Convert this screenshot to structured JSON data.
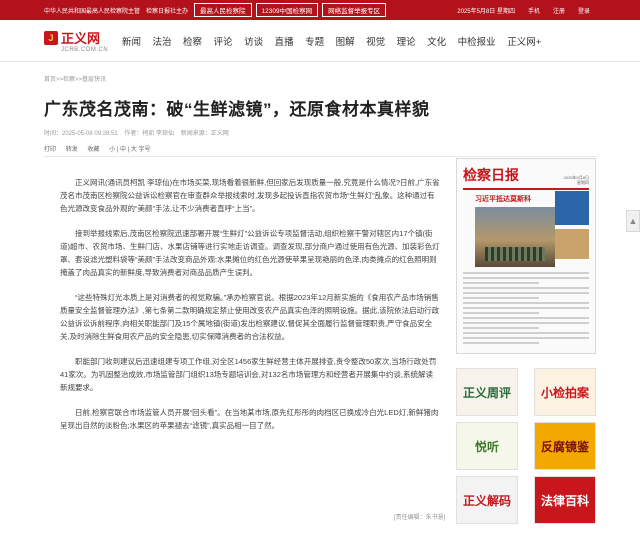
{
  "topbar": {
    "item1": "中华人民共和国最高人民检察院主管",
    "item2": "检察日报社主办",
    "btn1": "最高人民检察院",
    "btn2": "12309中国检察网",
    "btn3": "网络监督举报专区",
    "date": "2025年5月8日 星期四",
    "utils": [
      "手机",
      "注册",
      "登录"
    ]
  },
  "logo": {
    "name": "正义网",
    "sub": "JCRB.COM.CN"
  },
  "nav": [
    "新闻",
    "法治",
    "检察",
    "评论",
    "访谈",
    "直播",
    "专题",
    "图解",
    "视觉",
    "理论",
    "文化",
    "中检报业",
    "正义网+"
  ],
  "breadcrumb": "首页>>检察>>基层快讯",
  "article": {
    "title": "广东茂名茂南：破“生鲜滤镜”，还原食材本真样貌",
    "meta": [
      "时间：2025-05-08 09:28:51",
      "作者：柯凯 李琼仙",
      "新闻来源：正义网"
    ],
    "tools": [
      "打印",
      "转发",
      "收藏",
      "小 | 中 | 大 字号"
    ],
    "paragraphs": [
      "正义网讯(通讯员柯凯 李琼仙)在市场买菜,现场看着很新鲜,但回家后发现质量一般,究竟是什么情况?日前,广东省茂名市茂南区检察院公益诉讼检察官在审查群众举报线索时,发现多起投诉直指农贸市场“生鲜灯”乱象。这种通过有色光源改变食品外观的“美颜”手法,让不少消费者直呼“上当”。",
      "接到举报线索后,茂南区检察院迅速部署开展“生鲜灯”公益诉讼专项监督活动,组织检察干警对辖区内17个镇(街道)超市、农贸市场、生鲜门店、水果店铺等进行实地走访调查。调查发现,部分商户通过使用有色光源、加装彩色灯罩、套设滤光塑料袋等“美颜”手法改变商品外观:水果摊位的红色光源使苹果呈现艳丽的色泽,肉类摊点的红色照明则掩盖了肉品真实的新鲜度,导致消费者对商品品质产生误判。",
      "“这些特殊灯光本质上是对消费者的视觉欺骗。”承办检察官说。根据2023年12月新实施的《食用农产品市场销售质量安全监督管理办法》,第七条第二款明确规定禁止使用改变农产品真实色泽的照明设施。据此,该院依法启动行政公益诉讼诉前程序,向相关职能部门及15个属地镇(街道)发出检察建议,督促其全面履行监督管理职责,严守食品安全关,及时消除生鲜食用农产品的安全隐患,切实保障消费者的合法权益。",
      "职能部门收到建议后迅速组建专项工作组,对全区1456家生鲜经营主体开展排查,责令整改50家次,当场行政处罚41家次。为巩固整治成效,市场监管部门组织13场专题培训会,对132名市场管理方和经营者开展集中约谈,系统解读新规要求。",
      "日前,检察官联合市场监管人员开展“回头看”。在当地某市场,原先红彤彤的肉档区已换成冷白光LED灯,新鲜猪肉呈现出自然的淡粉色;水果区的苹果褪去“滤镜”,真实品相一目了然。"
    ],
    "editor": "[责任编辑：朱书慧]"
  },
  "sidebar": {
    "paper": {
      "name": "检察日报",
      "date_line1": "2025年5月8日",
      "date_line2": "星期四",
      "headline": "习近平抵达莫斯科"
    },
    "badges": [
      "正义周评",
      "小检拍案",
      "悦听",
      "反腐镜鉴",
      "正义解码",
      "法律百科"
    ]
  },
  "scroll_top_icon": "arrow-up-icon"
}
